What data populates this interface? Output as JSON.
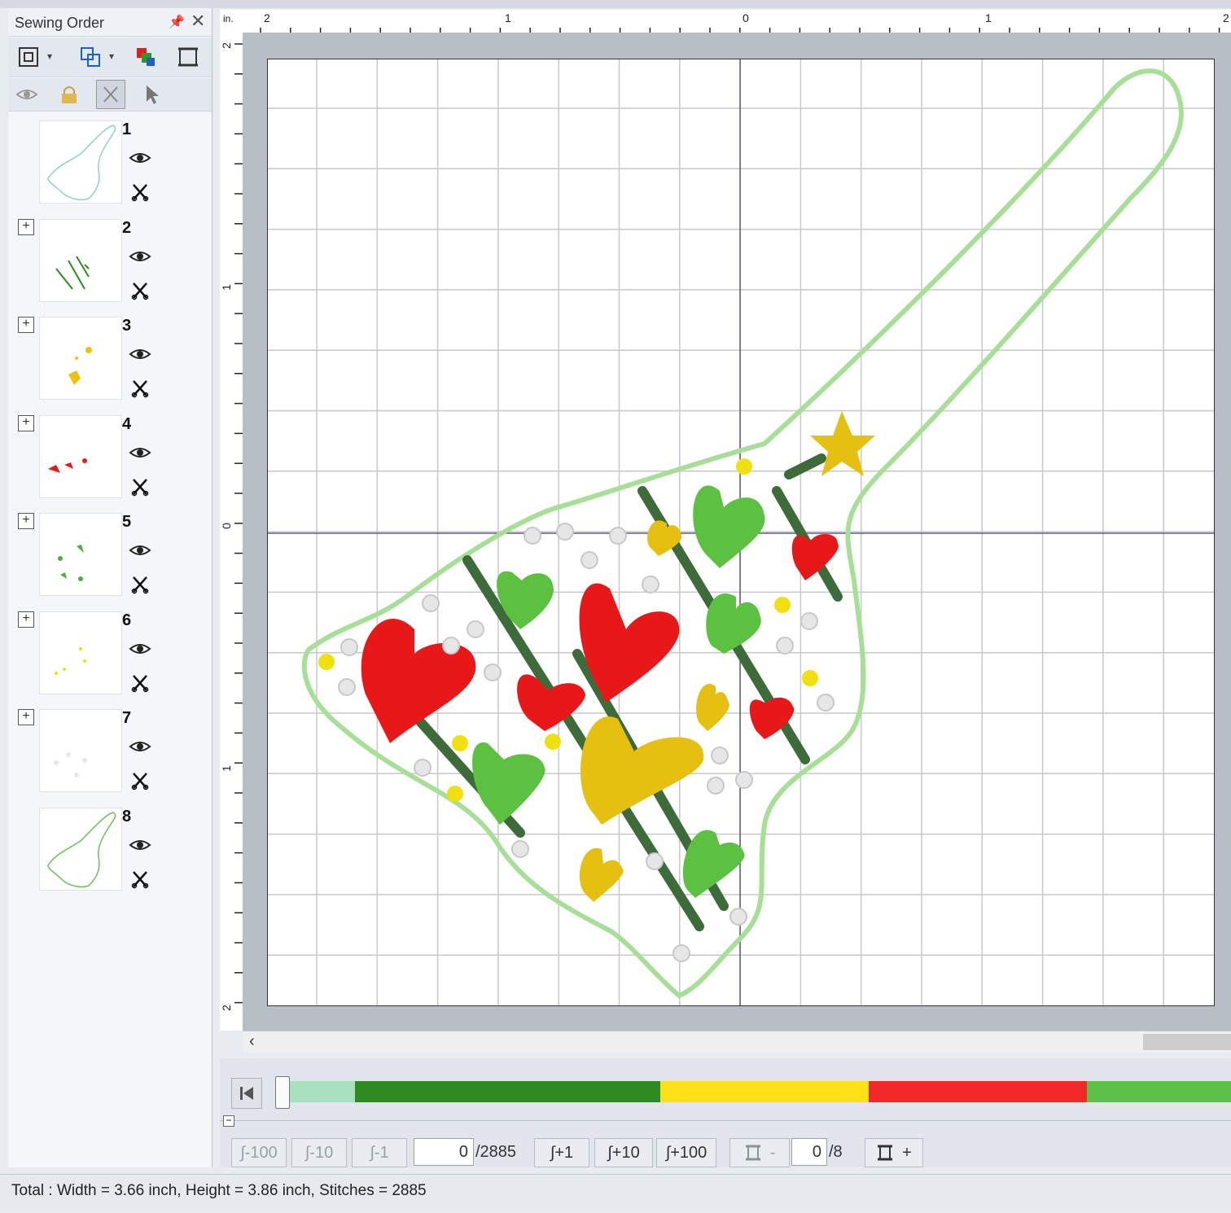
{
  "panel": {
    "title": "Sewing Order",
    "items": [
      {
        "number": "1",
        "has_expander": false
      },
      {
        "number": "2",
        "has_expander": true
      },
      {
        "number": "3",
        "has_expander": true
      },
      {
        "number": "4",
        "has_expander": true
      },
      {
        "number": "5",
        "has_expander": true
      },
      {
        "number": "6",
        "has_expander": true
      },
      {
        "number": "7",
        "has_expander": true
      },
      {
        "number": "8",
        "has_expander": false
      }
    ],
    "icons": [
      "fit-view-icon",
      "group-icon",
      "color-order-icon",
      "hoop-icon",
      "eye-icon",
      "lock-icon",
      "scissors-icon",
      "pointer-icon"
    ]
  },
  "ruler": {
    "unit": "in.",
    "top_labels": [
      "2",
      "1",
      "0",
      "1",
      "2"
    ],
    "left_labels": [
      "2",
      "1",
      "0",
      "1",
      "2"
    ]
  },
  "stitch_nav": {
    "back100": "-100",
    "back10": "-10",
    "back1": "-1",
    "current_stitch": "0",
    "total_stitches": "/2885",
    "fwd1": "+1",
    "fwd10": "+10",
    "fwd100": "+100",
    "color_minus": "-",
    "current_color": "0",
    "total_colors": "/8",
    "color_plus": "+"
  },
  "color_segments": [
    {
      "color": "#a8e0c0"
    },
    {
      "color": "#2e8b22"
    },
    {
      "color": "#ffe014"
    },
    {
      "color": "#f02828"
    },
    {
      "color": "#5cc048"
    }
  ],
  "status": {
    "text": "Total : Width = 3.66 inch, Height = 3.86 inch, Stitches = 2885"
  }
}
